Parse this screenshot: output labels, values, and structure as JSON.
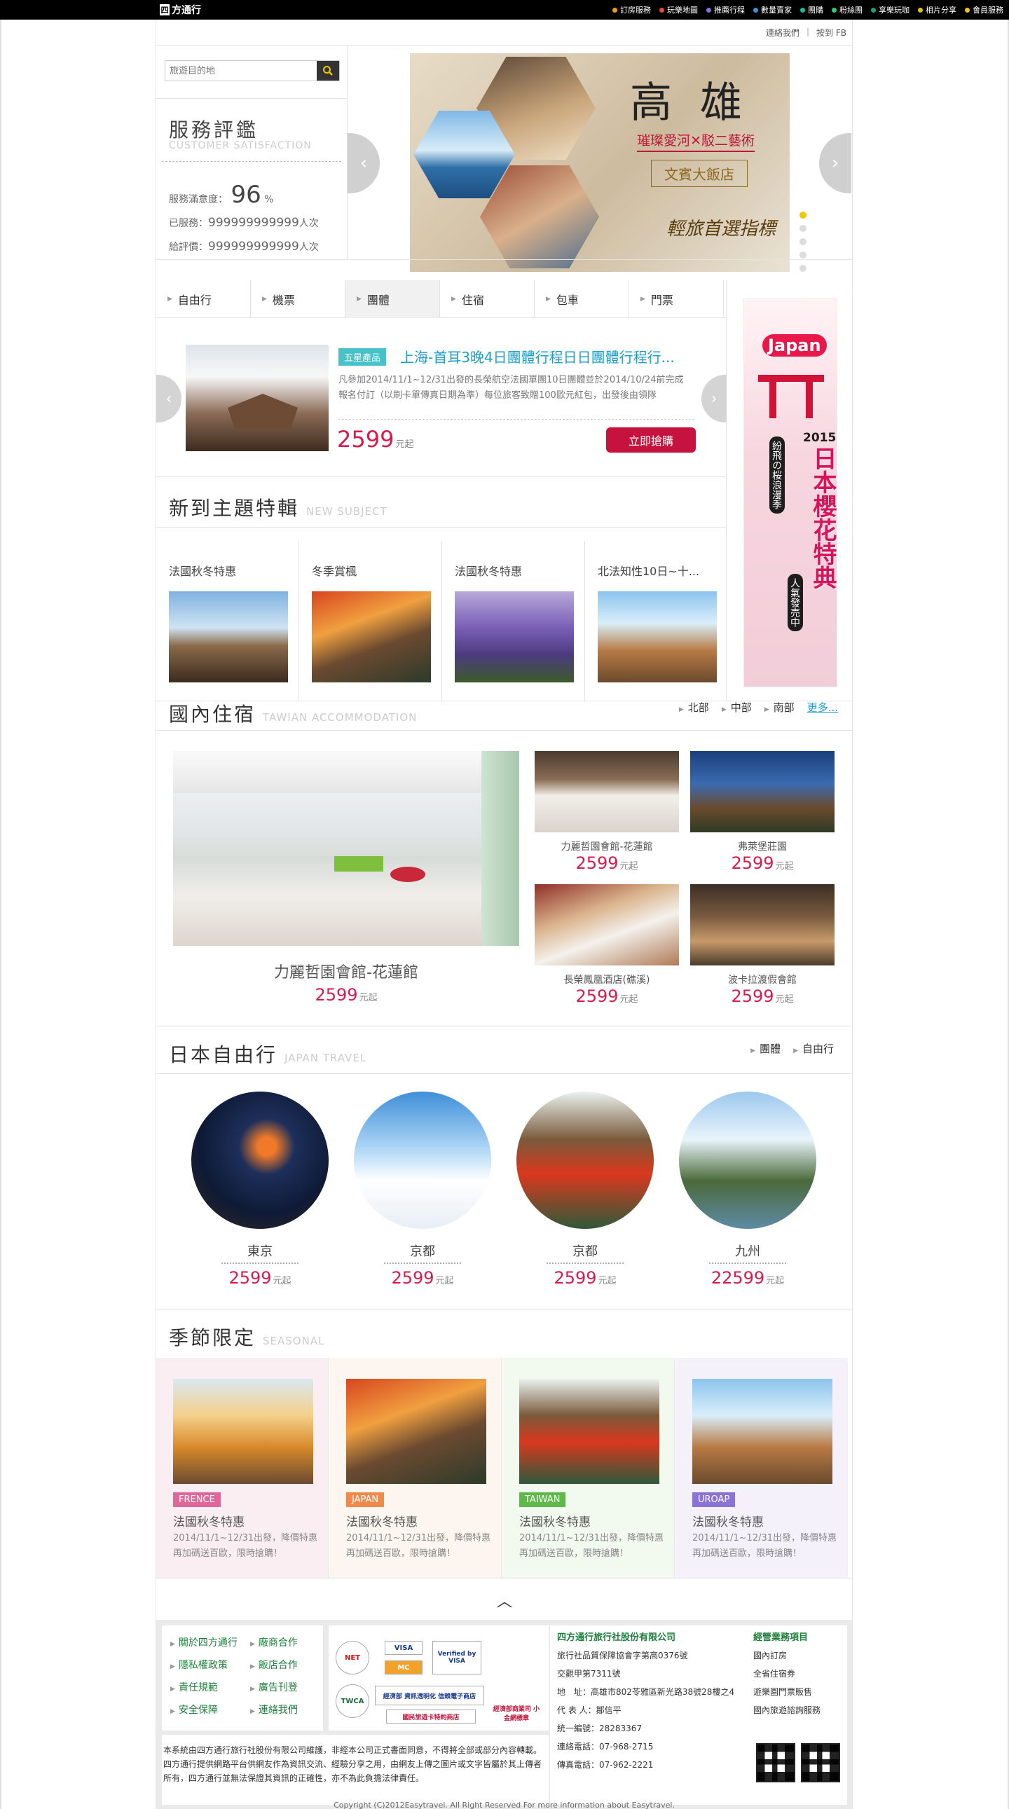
{
  "topbar": {
    "logo_box": "四",
    "logo_text": "方通行",
    "nav": [
      {
        "label": "訂房服務",
        "color": "#f39c12"
      },
      {
        "label": "玩樂地圖",
        "color": "#e74c3c"
      },
      {
        "label": "推薦行程",
        "color": "#8e6bd8"
      },
      {
        "label": "數量賣家",
        "color": "#3498db"
      },
      {
        "label": "團購",
        "color": "#1abc9c"
      },
      {
        "label": "粉絲團",
        "color": "#2ecc71"
      },
      {
        "label": "享樂玩咖",
        "color": "#16a085"
      },
      {
        "label": "相片分享",
        "color": "#e0c020"
      },
      {
        "label": "會員服務",
        "color": "#f1c40f"
      }
    ]
  },
  "util": {
    "contact": "連絡我們",
    "fb": "按到 FB"
  },
  "search": {
    "placeholder": "旅遊目的地"
  },
  "satisfaction": {
    "title": "服務評鑑",
    "subtitle": "CUSTOMER SATISFACTION",
    "rate_label": "服務滿意度：",
    "rate_value": "96",
    "rate_unit": "%",
    "served_label": "已服務：",
    "served_value": "999999999999",
    "served_unit": "人次",
    "review_label": "給評價：",
    "review_value": "999999999999",
    "review_unit": "人次"
  },
  "hero": {
    "city": "高雄",
    "art": "璀璨愛河✕駁二藝術",
    "hotel": "文賓大飯店",
    "slogan": "輕旅首選指標",
    "slides": 5,
    "active_slide": 1
  },
  "tabs": [
    "自由行",
    "機票",
    "團體",
    "住宿",
    "包車",
    "門票"
  ],
  "active_tab": 2,
  "promo": {
    "badge": "五星產品",
    "title": "上海-首耳3晚4日團體行程日日團體行程行...",
    "text": "凡參加2014/11/1~12/31出發的長榮航空法國單團10日團體並於2014/10/24前完成報名付訂（以刷卡單傳真日期為準）每位旅客致贈100歐元紅包，出發後由領隊",
    "price": "2599",
    "unit": "元起",
    "cta": "立即搶購"
  },
  "side_banner": {
    "japan": "Japan",
    "year": "2015",
    "title": "日本櫻花特典",
    "line1": "紛飛の桜浪漫季",
    "line2": "人氣發売中"
  },
  "new_subject": {
    "title": "新到主題特輯",
    "subtitle": "NEW SUBJECT",
    "items": [
      {
        "title": "法國秋冬特惠"
      },
      {
        "title": "冬季賞楓"
      },
      {
        "title": "法國秋冬特惠"
      },
      {
        "title": "北法知性10日~十..."
      }
    ]
  },
  "accommodation": {
    "title": "國內住宿",
    "subtitle": "TAWIAN ACCOMMODATION",
    "links": [
      "北部",
      "中部",
      "南部"
    ],
    "more": "更多...",
    "main": {
      "name": "力麗哲園會館-花蓮館",
      "price": "2599",
      "unit": "元起"
    },
    "items": [
      {
        "name": "力麗哲園會館-花蓮館",
        "price": "2599",
        "unit": "元起"
      },
      {
        "name": "弗萊堡莊園",
        "price": "2599",
        "unit": "元起"
      },
      {
        "name": "長榮鳳凰酒店(礁溪)",
        "price": "2599",
        "unit": "元起"
      },
      {
        "name": "波卡拉渡假會館",
        "price": "2599",
        "unit": "元起"
      }
    ]
  },
  "japan": {
    "title": "日本自由行",
    "subtitle": "JAPAN TRAVEL",
    "links": [
      "團體",
      "自由行"
    ],
    "items": [
      {
        "name": "東京",
        "price": "2599",
        "unit": "元起"
      },
      {
        "name": "京都",
        "price": "2599",
        "unit": "元起"
      },
      {
        "name": "京都",
        "price": "2599",
        "unit": "元起"
      },
      {
        "name": "九州",
        "price": "22599",
        "unit": "元起"
      }
    ]
  },
  "seasonal": {
    "title": "季節限定",
    "subtitle": "SEASONAL",
    "items": [
      {
        "tag": "FRENCE",
        "tag_color": "#e0679a",
        "bg": "#fbeef3",
        "title": "法國秋冬特惠",
        "desc": "2014/11/1~12/31出發，降價特惠再加碼送百歐，限時搶購！"
      },
      {
        "tag": "JAPAN",
        "tag_color": "#f08a4b",
        "bg": "#fdf6f0",
        "title": "法國秋冬特惠",
        "desc": "2014/11/1~12/31出發，降價特惠再加碼送百歐，限時搶購！"
      },
      {
        "tag": "TAIWAN",
        "tag_color": "#5fb94a",
        "bg": "#f2f9ef",
        "title": "法國秋冬特惠",
        "desc": "2014/11/1~12/31出發，降價特惠再加碼送百歐，限時搶購！"
      },
      {
        "tag": "UROAP",
        "tag_color": "#8b72d6",
        "bg": "#f5f1fb",
        "title": "法國秋冬特惠",
        "desc": "2014/11/1~12/31出發，降價特惠再加碼送百歐，限時搶購！"
      }
    ]
  },
  "footer": {
    "links": [
      "關於四方通行",
      "廠商合作",
      "隱私權政策",
      "飯店合作",
      "責任規範",
      "廣告刊登",
      "安全保障",
      "連絡我們"
    ],
    "certs": [
      "NET",
      "VISA",
      "Verified by VISA",
      "TWCA",
      "經濟部 資訊透明化 信賴電子商店",
      "國民旅遊卡特約商店",
      "經濟部商業司 小金網標章"
    ],
    "company": "四方通行旅行社股份有限公司",
    "info": [
      "旅行社品質保障協會字第高0376號",
      "交觀甲第7311號",
      "地　址：高雄市802苓雅區新光路38號28樓之4",
      "代 表 人：鄒信平",
      "統一編號：28283367",
      "連絡電話：07-968-2715",
      "傳真電話：07-962-2221"
    ],
    "services_title": "經營業務項目",
    "services": [
      "國內訂房",
      "全省住宿券",
      "遊樂園門票販售",
      "國內旅遊諮詢服務"
    ],
    "note": "本系統由四方通行旅行社股份有限公司維護，非經本公司正式書面同意，不得將全部或部分內容轉載。四方通行提供網路平台供網友作為資訊交流、經驗分享之用，由網友上傳之圖片或文字皆屬於其上傳者所有，四方通行並無法保證其資訊的正確性，亦不為此負擔法律責任。",
    "copyright": "Copyright (C)2012Easytravel. All Right Reserved For more information about Easytravel."
  }
}
